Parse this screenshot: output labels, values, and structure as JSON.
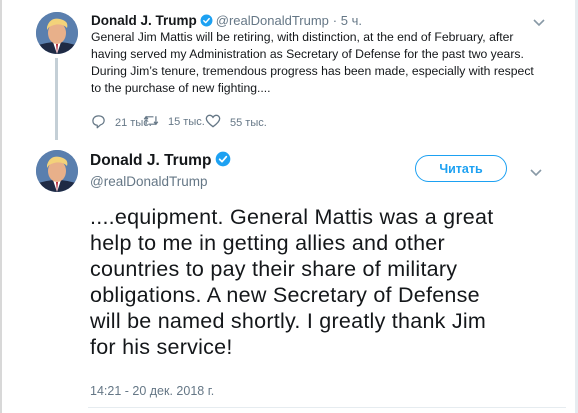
{
  "parent_tweet": {
    "name": "Donald J. Trump",
    "handle": "@realDonaldTrump",
    "separator": "·",
    "time": "5 ч.",
    "text_lines": [
      "General Jim Mattis will be retiring, with distinction, at the end of February, after",
      "having served my Administration as Secretary of Defense for the past two years.",
      "During Jim’s tenure, tremendous progress has been made, especially with respect",
      "to the purchase of new fighting...."
    ],
    "replies": "21 тыс.",
    "retweets": "15 тыс.",
    "likes": "55 тыс."
  },
  "main_tweet": {
    "name": "Donald J. Trump",
    "handle": "@realDonaldTrump",
    "follow_label": "Читать",
    "text_lines": [
      "....equipment. General Mattis was a great",
      "help to me in getting allies and other",
      "countries to pay their share of military",
      "obligations. A new Secretary of Defense",
      "will be named shortly. I greatly thank Jim",
      "for his service!"
    ],
    "date": "14:21 - 20 дек. 2018 г."
  },
  "icons": {
    "verified": "verified-badge-icon",
    "chevron": "chevron-down-icon",
    "reply": "reply-icon",
    "retweet": "retweet-icon",
    "like": "heart-icon"
  },
  "colors": {
    "accent": "#1da1f2",
    "secondary_text": "#657786",
    "thread_line": "#c4cfd6"
  }
}
